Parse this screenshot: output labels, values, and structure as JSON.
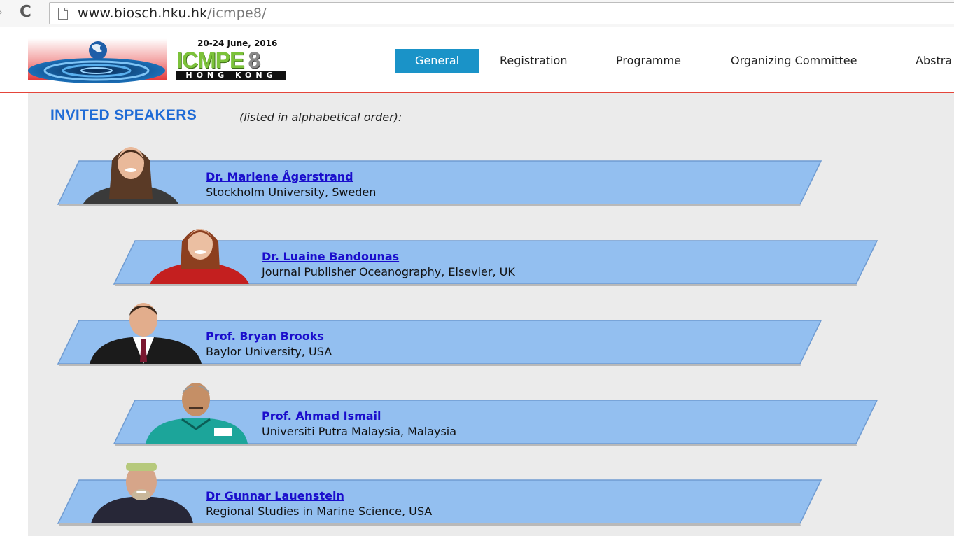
{
  "browser": {
    "url_host": "www.biosch.hku.hk",
    "url_path": "/icmpe8/"
  },
  "header": {
    "date": "20-24 June, 2016",
    "conf_name": "ICMPE",
    "conf_number": "8",
    "city": "HONG KONG"
  },
  "nav": {
    "items": [
      {
        "label": "General",
        "active": true
      },
      {
        "label": "Registration",
        "active": false
      },
      {
        "label": "Programme",
        "active": false
      },
      {
        "label": "Organizing Committee",
        "active": false
      },
      {
        "label": "Abstra",
        "active": false
      }
    ]
  },
  "main": {
    "title": "INVITED SPEAKERS",
    "note": "(listed in alphabetical order):",
    "speakers": [
      {
        "name": "Dr. Marlene Ågerstrand",
        "affiliation": "Stockholm University, Sweden",
        "photo": "speaker-photo-woman-dark-hair"
      },
      {
        "name": "Dr. Luaine Bandounas",
        "affiliation": "Journal Publisher Oceanography, Elsevier, UK",
        "photo": "speaker-photo-woman-red-hair"
      },
      {
        "name": "Prof. Bryan Brooks",
        "affiliation": "Baylor University, USA",
        "photo": "speaker-photo-man-suit"
      },
      {
        "name": "Prof. Ahmad Ismail",
        "affiliation": "Universiti Putra Malaysia, Malaysia",
        "photo": "speaker-photo-man-green-shirt"
      },
      {
        "name": "Dr Gunnar Lauenstein",
        "affiliation": "Regional Studies in Marine Science, USA",
        "photo": "speaker-photo-man-diving-suit"
      }
    ]
  },
  "colors": {
    "banner": "#93bff0",
    "nav_active": "#1a93c8",
    "title": "#1f6bd6",
    "link": "#1a0dcc",
    "header_rule": "#e4453a"
  }
}
